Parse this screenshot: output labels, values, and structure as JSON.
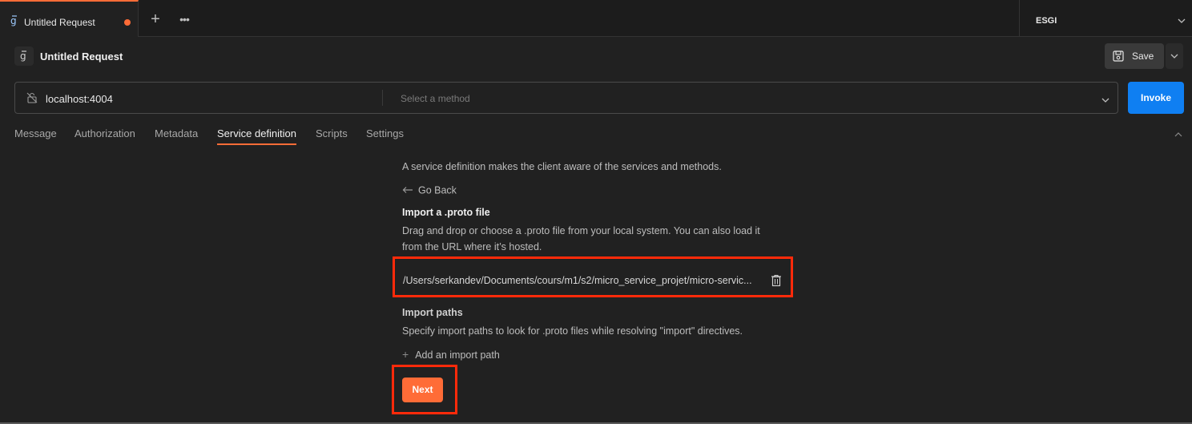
{
  "tabs": {
    "active_label": "Untitled Request",
    "new_tab_glyph": "+",
    "more_glyph": "•••"
  },
  "environment": {
    "label": "ESGI"
  },
  "request": {
    "title": "Untitled Request",
    "save_label": "Save",
    "url": "localhost:4004",
    "method_placeholder": "Select a method",
    "invoke_label": "Invoke"
  },
  "subtabs": [
    {
      "label": "Message"
    },
    {
      "label": "Authorization"
    },
    {
      "label": "Metadata"
    },
    {
      "label": "Service definition"
    },
    {
      "label": "Scripts"
    },
    {
      "label": "Settings"
    }
  ],
  "service_definition": {
    "description": "A service definition makes the client aware of the services and methods.",
    "go_back": "Go Back",
    "import_title": "Import a .proto file",
    "import_desc_line1": "Drag and drop or choose a .proto file from your local system. You can also load it",
    "import_desc_line2": "from the URL where it’s hosted.",
    "file_path": "/Users/serkandev/Documents/cours/m1/s2/micro_service_projet/micro-servic...",
    "import_paths_title": "Import paths",
    "import_paths_desc": "Specify import paths to look for .proto files while resolving \"import\" directives.",
    "add_import_label": "Add an import path",
    "next_label": "Next"
  },
  "colors": {
    "accent": "#ff6c37",
    "invoke": "#0f7ff2",
    "highlight": "#ff2a0a"
  },
  "icons": {
    "tab": "grpc-icon",
    "request": "grpc-icon",
    "save": "save-icon",
    "connection": "unlocked-icon",
    "delete": "trash-icon"
  }
}
